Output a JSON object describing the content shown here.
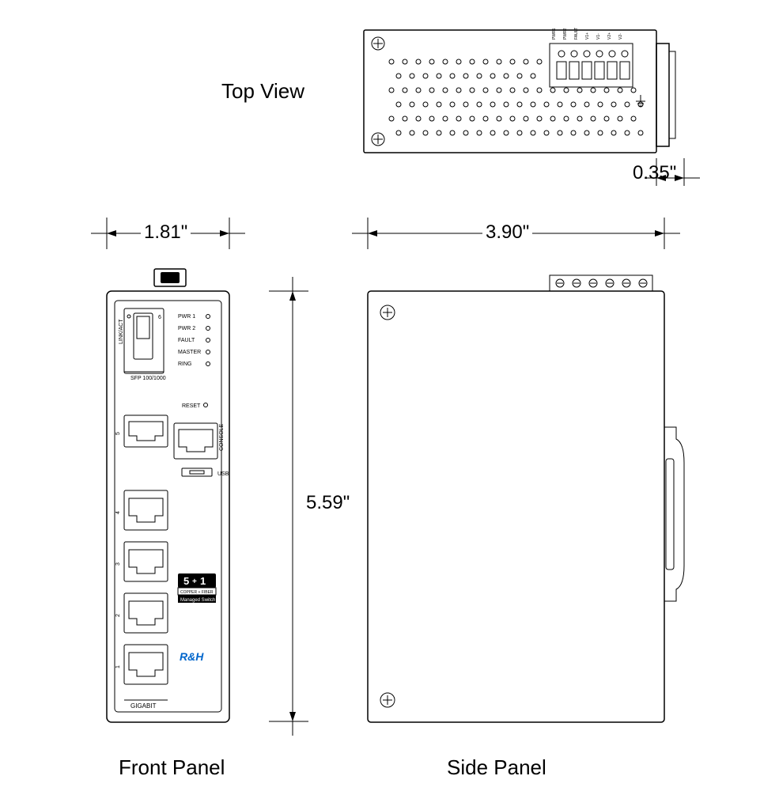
{
  "views": {
    "top": "Top View",
    "front": "Front Panel",
    "side": "Side Panel"
  },
  "dimensions": {
    "front_width": "1.81\"",
    "height": "5.59\"",
    "side_depth": "3.90\"",
    "clip_depth": "0.35\""
  },
  "front_panel": {
    "leds": [
      "PWR 1",
      "PWR 2",
      "FAULT",
      "MASTER",
      "RING"
    ],
    "reset": "RESET",
    "sfp_link": "LINK/ACT",
    "sfp_label": "SFP 100/1000",
    "sfp_port_num": "6",
    "console": "CONSOLE",
    "usb": "USB",
    "port_nums": [
      "5",
      "4",
      "3",
      "2",
      "1"
    ],
    "gigabit": "GIGABIT",
    "badge_top": "5+1",
    "badge_mid": "COPPER + FIBER",
    "badge_bot": "Managed Switch",
    "logo": "R&H"
  },
  "top_panel": {
    "terminals": [
      "PWR1",
      "PWR2",
      "FAULT",
      "V1+",
      "V1-",
      "V2+",
      "V2-"
    ]
  }
}
